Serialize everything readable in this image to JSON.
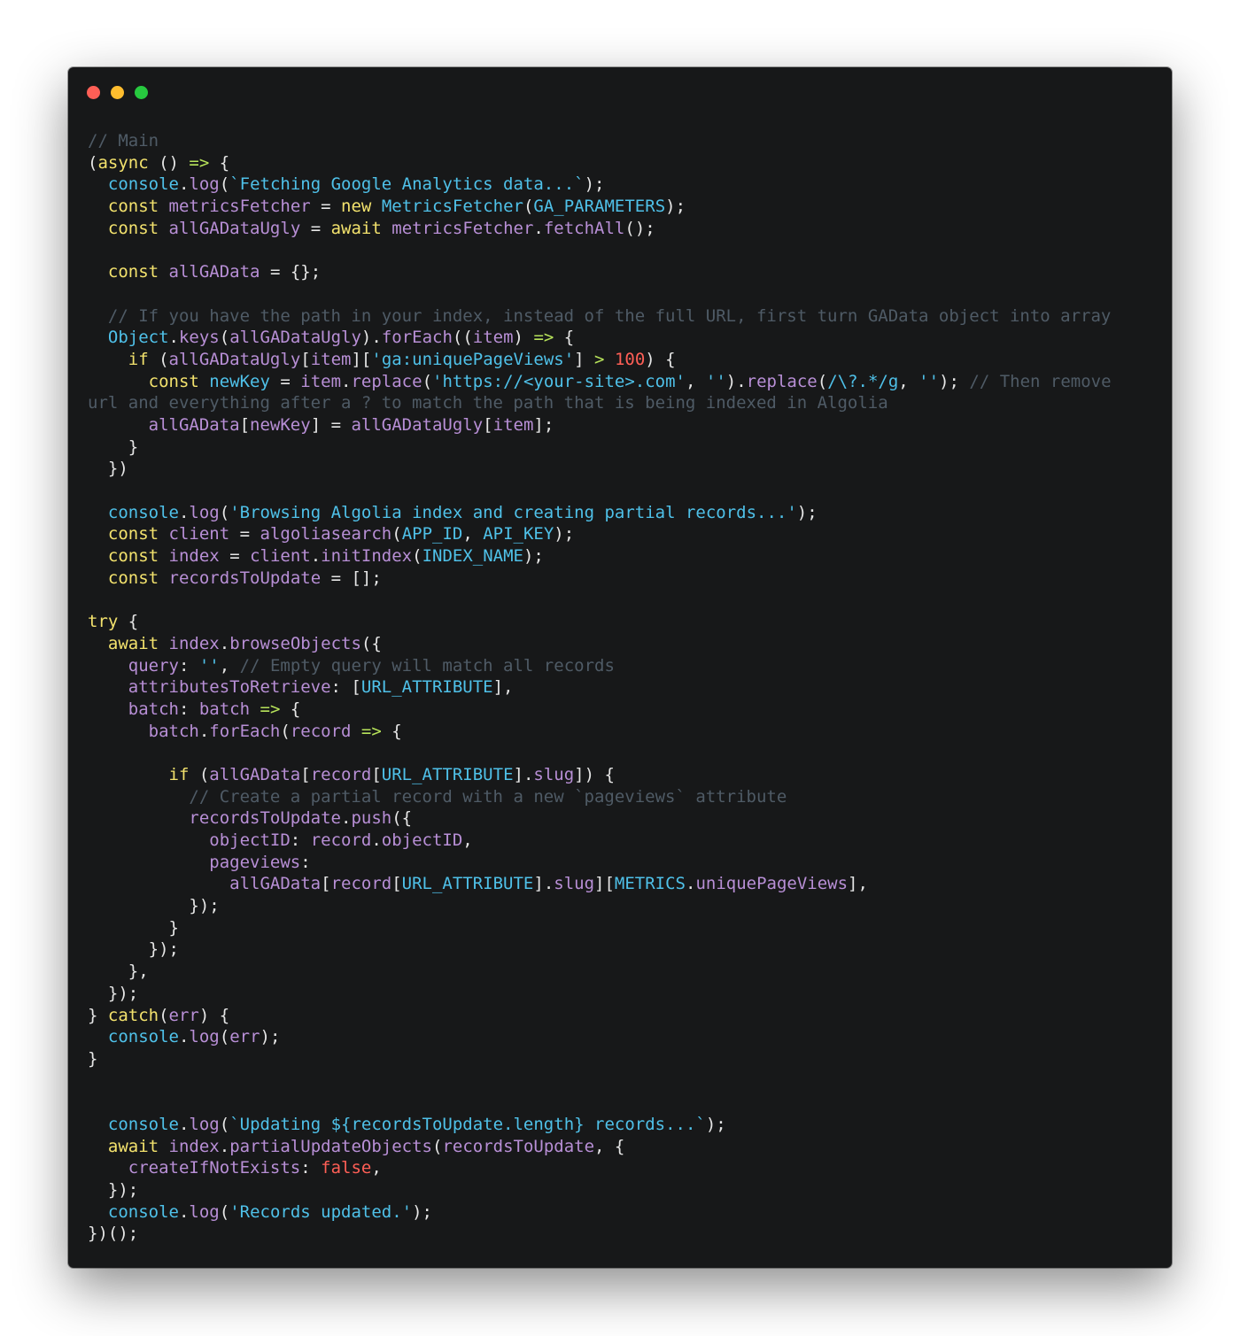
{
  "window": {
    "controls": [
      "close",
      "minimize",
      "maximize"
    ]
  },
  "code_lines": [
    [
      [
        "c",
        "// Main"
      ]
    ],
    [
      [
        "w",
        "("
      ],
      [
        "k",
        "async"
      ],
      [
        "w",
        " () "
      ],
      [
        "o",
        "=>"
      ],
      [
        "w",
        " {"
      ]
    ],
    [
      [
        "w",
        "  "
      ],
      [
        "b",
        "console"
      ],
      [
        "w",
        "."
      ],
      [
        "p",
        "log"
      ],
      [
        "w",
        "("
      ],
      [
        "s",
        "`Fetching Google Analytics data...`"
      ],
      [
        "w",
        ");"
      ]
    ],
    [
      [
        "w",
        "  "
      ],
      [
        "k",
        "const"
      ],
      [
        "w",
        " "
      ],
      [
        "p",
        "metricsFetcher"
      ],
      [
        "w",
        " = "
      ],
      [
        "k",
        "new"
      ],
      [
        "w",
        " "
      ],
      [
        "b",
        "MetricsFetcher"
      ],
      [
        "w",
        "("
      ],
      [
        "b",
        "GA_PARAMETERS"
      ],
      [
        "w",
        ");"
      ]
    ],
    [
      [
        "w",
        "  "
      ],
      [
        "k",
        "const"
      ],
      [
        "w",
        " "
      ],
      [
        "p",
        "allGADataUgly"
      ],
      [
        "w",
        " = "
      ],
      [
        "k",
        "await"
      ],
      [
        "w",
        " "
      ],
      [
        "p",
        "metricsFetcher"
      ],
      [
        "w",
        "."
      ],
      [
        "p",
        "fetchAll"
      ],
      [
        "w",
        "();"
      ]
    ],
    [],
    [
      [
        "w",
        "  "
      ],
      [
        "k",
        "const"
      ],
      [
        "w",
        " "
      ],
      [
        "p",
        "allGAData"
      ],
      [
        "w",
        " = {};"
      ]
    ],
    [],
    [
      [
        "w",
        "  "
      ],
      [
        "c",
        "// If you have the path in your index, instead of the full URL, first turn GAData object into array"
      ]
    ],
    [
      [
        "w",
        "  "
      ],
      [
        "b",
        "Object"
      ],
      [
        "w",
        "."
      ],
      [
        "p",
        "keys"
      ],
      [
        "w",
        "("
      ],
      [
        "p",
        "allGADataUgly"
      ],
      [
        "w",
        ")."
      ],
      [
        "p",
        "forEach"
      ],
      [
        "w",
        "(("
      ],
      [
        "p",
        "item"
      ],
      [
        "w",
        ") "
      ],
      [
        "o",
        "=>"
      ],
      [
        "w",
        " {"
      ]
    ],
    [
      [
        "w",
        "    "
      ],
      [
        "k",
        "if"
      ],
      [
        "w",
        " ("
      ],
      [
        "p",
        "allGADataUgly"
      ],
      [
        "w",
        "["
      ],
      [
        "p",
        "item"
      ],
      [
        "w",
        "]["
      ],
      [
        "s",
        "'ga:uniquePageViews'"
      ],
      [
        "w",
        "] "
      ],
      [
        "o",
        ">"
      ],
      [
        "w",
        " "
      ],
      [
        "n",
        "100"
      ],
      [
        "w",
        ") {"
      ]
    ],
    [
      [
        "w",
        "      "
      ],
      [
        "k",
        "const"
      ],
      [
        "w",
        " "
      ],
      [
        "b",
        "newKey"
      ],
      [
        "w",
        " = "
      ],
      [
        "p",
        "item"
      ],
      [
        "w",
        "."
      ],
      [
        "p",
        "replace"
      ],
      [
        "w",
        "("
      ],
      [
        "s",
        "'https://<your-site>.com'"
      ],
      [
        "w",
        ", "
      ],
      [
        "s",
        "''"
      ],
      [
        "w",
        ")."
      ],
      [
        "p",
        "replace"
      ],
      [
        "w",
        "("
      ],
      [
        "s",
        "/\\?.*/g"
      ],
      [
        "w",
        ", "
      ],
      [
        "s",
        "''"
      ],
      [
        "w",
        "); "
      ],
      [
        "c",
        "// Then remove"
      ]
    ],
    [
      [
        "c",
        "url and everything after a ? to match the path that is being indexed in Algolia"
      ]
    ],
    [
      [
        "w",
        "      "
      ],
      [
        "p",
        "allGAData"
      ],
      [
        "w",
        "["
      ],
      [
        "p",
        "newKey"
      ],
      [
        "w",
        "] = "
      ],
      [
        "p",
        "allGADataUgly"
      ],
      [
        "w",
        "["
      ],
      [
        "p",
        "item"
      ],
      [
        "w",
        "];"
      ]
    ],
    [
      [
        "w",
        "    }"
      ]
    ],
    [
      [
        "w",
        "  })"
      ]
    ],
    [],
    [
      [
        "w",
        "  "
      ],
      [
        "b",
        "console"
      ],
      [
        "w",
        "."
      ],
      [
        "p",
        "log"
      ],
      [
        "w",
        "("
      ],
      [
        "s",
        "'Browsing Algolia index and creating partial records...'"
      ],
      [
        "w",
        ");"
      ]
    ],
    [
      [
        "w",
        "  "
      ],
      [
        "k",
        "const"
      ],
      [
        "w",
        " "
      ],
      [
        "p",
        "client"
      ],
      [
        "w",
        " = "
      ],
      [
        "p",
        "algoliasearch"
      ],
      [
        "w",
        "("
      ],
      [
        "b",
        "APP_ID"
      ],
      [
        "w",
        ", "
      ],
      [
        "b",
        "API_KEY"
      ],
      [
        "w",
        ");"
      ]
    ],
    [
      [
        "w",
        "  "
      ],
      [
        "k",
        "const"
      ],
      [
        "w",
        " "
      ],
      [
        "p",
        "index"
      ],
      [
        "w",
        " = "
      ],
      [
        "p",
        "client"
      ],
      [
        "w",
        "."
      ],
      [
        "p",
        "initIndex"
      ],
      [
        "w",
        "("
      ],
      [
        "b",
        "INDEX_NAME"
      ],
      [
        "w",
        ");"
      ]
    ],
    [
      [
        "w",
        "  "
      ],
      [
        "k",
        "const"
      ],
      [
        "w",
        " "
      ],
      [
        "p",
        "recordsToUpdate"
      ],
      [
        "w",
        " = [];"
      ]
    ],
    [],
    [
      [
        "k",
        "try"
      ],
      [
        "w",
        " {"
      ]
    ],
    [
      [
        "w",
        "  "
      ],
      [
        "k",
        "await"
      ],
      [
        "w",
        " "
      ],
      [
        "p",
        "index"
      ],
      [
        "w",
        "."
      ],
      [
        "p",
        "browseObjects"
      ],
      [
        "w",
        "({"
      ]
    ],
    [
      [
        "w",
        "    "
      ],
      [
        "p",
        "query"
      ],
      [
        "w",
        ": "
      ],
      [
        "s",
        "''"
      ],
      [
        "w",
        ", "
      ],
      [
        "c",
        "// Empty query will match all records"
      ]
    ],
    [
      [
        "w",
        "    "
      ],
      [
        "p",
        "attributesToRetrieve"
      ],
      [
        "w",
        ": ["
      ],
      [
        "b",
        "URL_ATTRIBUTE"
      ],
      [
        "w",
        "],"
      ]
    ],
    [
      [
        "w",
        "    "
      ],
      [
        "p",
        "batch"
      ],
      [
        "w",
        ": "
      ],
      [
        "p",
        "batch"
      ],
      [
        "w",
        " "
      ],
      [
        "o",
        "=>"
      ],
      [
        "w",
        " {"
      ]
    ],
    [
      [
        "w",
        "      "
      ],
      [
        "p",
        "batch"
      ],
      [
        "w",
        "."
      ],
      [
        "p",
        "forEach"
      ],
      [
        "w",
        "("
      ],
      [
        "p",
        "record"
      ],
      [
        "w",
        " "
      ],
      [
        "o",
        "=>"
      ],
      [
        "w",
        " {"
      ]
    ],
    [],
    [
      [
        "w",
        "        "
      ],
      [
        "k",
        "if"
      ],
      [
        "w",
        " ("
      ],
      [
        "p",
        "allGAData"
      ],
      [
        "w",
        "["
      ],
      [
        "p",
        "record"
      ],
      [
        "w",
        "["
      ],
      [
        "b",
        "URL_ATTRIBUTE"
      ],
      [
        "w",
        "]."
      ],
      [
        "p",
        "slug"
      ],
      [
        "w",
        "]) {"
      ]
    ],
    [
      [
        "w",
        "          "
      ],
      [
        "c",
        "// Create a partial record with a new `pageviews` attribute"
      ]
    ],
    [
      [
        "w",
        "          "
      ],
      [
        "p",
        "recordsToUpdate"
      ],
      [
        "w",
        "."
      ],
      [
        "p",
        "push"
      ],
      [
        "w",
        "({"
      ]
    ],
    [
      [
        "w",
        "            "
      ],
      [
        "p",
        "objectID"
      ],
      [
        "w",
        ": "
      ],
      [
        "p",
        "record"
      ],
      [
        "w",
        "."
      ],
      [
        "p",
        "objectID"
      ],
      [
        "w",
        ","
      ]
    ],
    [
      [
        "w",
        "            "
      ],
      [
        "p",
        "pageviews"
      ],
      [
        "w",
        ":"
      ]
    ],
    [
      [
        "w",
        "              "
      ],
      [
        "p",
        "allGAData"
      ],
      [
        "w",
        "["
      ],
      [
        "p",
        "record"
      ],
      [
        "w",
        "["
      ],
      [
        "b",
        "URL_ATTRIBUTE"
      ],
      [
        "w",
        "]."
      ],
      [
        "p",
        "slug"
      ],
      [
        "w",
        "]["
      ],
      [
        "b",
        "METRICS"
      ],
      [
        "w",
        "."
      ],
      [
        "p",
        "uniquePageViews"
      ],
      [
        "w",
        "],"
      ]
    ],
    [
      [
        "w",
        "          });"
      ]
    ],
    [
      [
        "w",
        "        }"
      ]
    ],
    [
      [
        "w",
        "      });"
      ]
    ],
    [
      [
        "w",
        "    },"
      ]
    ],
    [
      [
        "w",
        "  });"
      ]
    ],
    [
      [
        "w",
        "} "
      ],
      [
        "k",
        "catch"
      ],
      [
        "w",
        "("
      ],
      [
        "p",
        "err"
      ],
      [
        "w",
        ") {"
      ]
    ],
    [
      [
        "w",
        "  "
      ],
      [
        "b",
        "console"
      ],
      [
        "w",
        "."
      ],
      [
        "p",
        "log"
      ],
      [
        "w",
        "("
      ],
      [
        "p",
        "err"
      ],
      [
        "w",
        ");"
      ]
    ],
    [
      [
        "w",
        "}"
      ]
    ],
    [],
    [],
    [
      [
        "w",
        "  "
      ],
      [
        "b",
        "console"
      ],
      [
        "w",
        "."
      ],
      [
        "p",
        "log"
      ],
      [
        "w",
        "("
      ],
      [
        "s",
        "`Updating ${recordsToUpdate.length} records...`"
      ],
      [
        "w",
        ");"
      ]
    ],
    [
      [
        "w",
        "  "
      ],
      [
        "k",
        "await"
      ],
      [
        "w",
        " "
      ],
      [
        "p",
        "index"
      ],
      [
        "w",
        "."
      ],
      [
        "p",
        "partialUpdateObjects"
      ],
      [
        "w",
        "("
      ],
      [
        "p",
        "recordsToUpdate"
      ],
      [
        "w",
        ", {"
      ]
    ],
    [
      [
        "w",
        "    "
      ],
      [
        "p",
        "createIfNotExists"
      ],
      [
        "w",
        ": "
      ],
      [
        "n",
        "false"
      ],
      [
        "w",
        ","
      ]
    ],
    [
      [
        "w",
        "  });"
      ]
    ],
    [
      [
        "w",
        "  "
      ],
      [
        "b",
        "console"
      ],
      [
        "w",
        "."
      ],
      [
        "p",
        "log"
      ],
      [
        "w",
        "("
      ],
      [
        "s",
        "'Records updated.'"
      ],
      [
        "w",
        ");"
      ]
    ],
    [
      [
        "w",
        "})();"
      ]
    ]
  ]
}
